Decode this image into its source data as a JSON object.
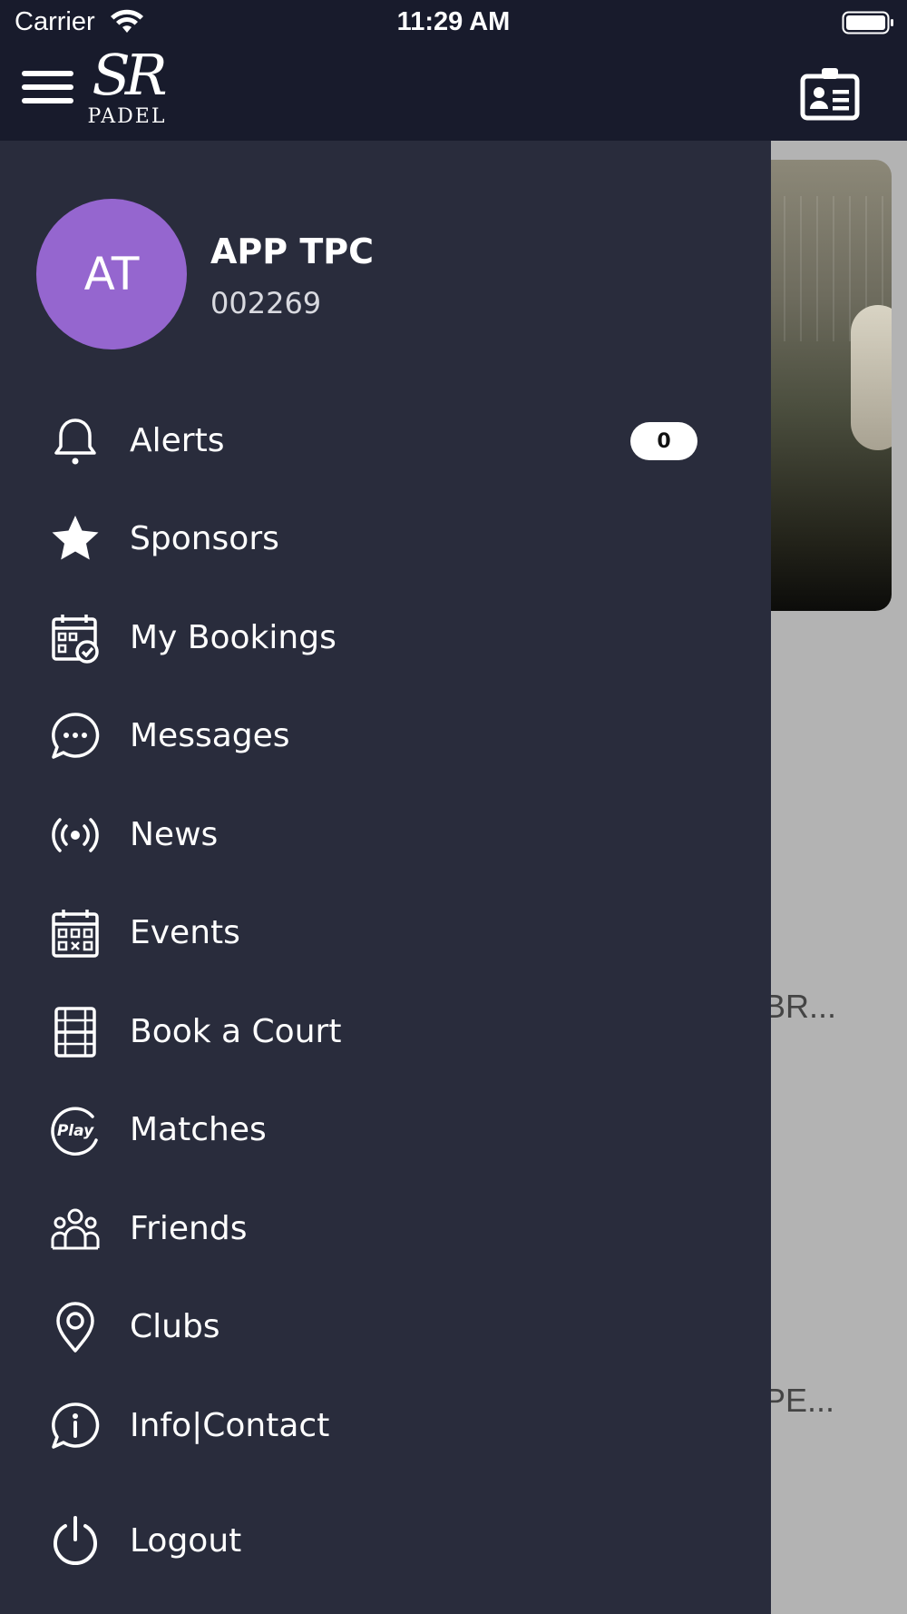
{
  "status_bar": {
    "carrier": "Carrier",
    "time": "11:29 AM"
  },
  "header": {
    "logo_mark": "SR",
    "logo_text": "PADEL",
    "left_icon": "menu-icon",
    "right_icon": "contact-card-icon"
  },
  "background": {
    "text_1": "BR...",
    "text_2": "PE..."
  },
  "profile": {
    "initials": "AT",
    "name": "APP TPC",
    "member_id": "002269",
    "avatar_color": "#9566cf"
  },
  "menu": {
    "alerts": {
      "label": "Alerts",
      "icon": "bell-icon",
      "badge": "0"
    },
    "sponsors": {
      "label": "Sponsors",
      "icon": "star-icon"
    },
    "my_bookings": {
      "label": "My Bookings",
      "icon": "calendar-check-icon"
    },
    "messages": {
      "label": "Messages",
      "icon": "chat-bubble-icon"
    },
    "news": {
      "label": "News",
      "icon": "broadcast-icon"
    },
    "events": {
      "label": "Events",
      "icon": "calendar-grid-icon"
    },
    "book_a_court": {
      "label": "Book a Court",
      "icon": "court-icon"
    },
    "matches": {
      "label": "Matches",
      "icon": "play-icon"
    },
    "friends": {
      "label": "Friends",
      "icon": "group-icon"
    },
    "clubs": {
      "label": "Clubs",
      "icon": "location-pin-icon"
    },
    "info_contact": {
      "label": "Info|Contact",
      "icon": "info-bubble-icon"
    },
    "logout": {
      "label": "Logout",
      "icon": "power-icon"
    }
  },
  "colors": {
    "header_bg": "#181b2c",
    "drawer_bg": "#292c3c",
    "page_bg": "#b3b3b3"
  }
}
